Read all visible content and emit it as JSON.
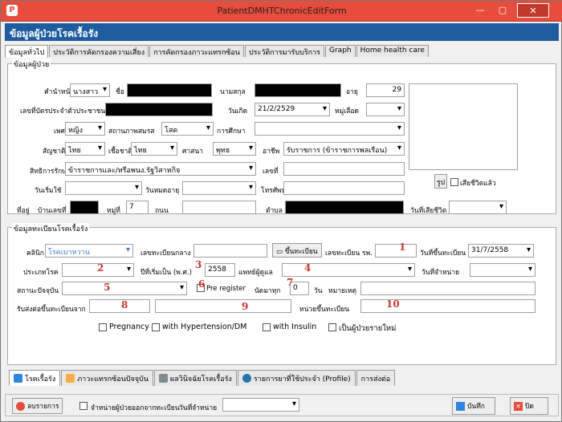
{
  "window": {
    "title": "PatientDMHTChronicEditForm",
    "app_icon": "P"
  },
  "header": {
    "title": "ข้อมูลผู้ป่วยโรคเรื้อรัง"
  },
  "tabs": [
    "ข้อมูลทั่วไป",
    "ประวัติการคัดกรองความเสี่ยง",
    "การคัดกรองภาวะแทรกซ้อน",
    "ประวัติการมารับบริการ",
    "Graph",
    "Home health care"
  ],
  "patient": {
    "group_title": "ข้อมูลผู้ป่วย",
    "prefix_label": "คำนำหน้า",
    "prefix_value": "นางสาว",
    "name_label": "ชื่อ",
    "surname_label": "นามสกุล",
    "age_label": "อายุ",
    "age_value": "29",
    "cid_label": "เลขที่บัตรประจำตัวประชาชน",
    "birth_label": "วันเกิด",
    "birth_value": "21/2/2529",
    "blood_label": "หมู่เลือด",
    "sex_label": "เพศ",
    "sex_value": "หญิง",
    "marital_label": "สถานภาพสมรส",
    "marital_value": "โสด",
    "education_label": "การศึกษา",
    "race_label": "สัญชาติ",
    "race_value": "ไทย",
    "nation_label": "เชื้อชาติ",
    "nation_value": "ไทย",
    "religion_label": "ศาสนา",
    "religion_value": "พุทธ",
    "occupation_label": "อาชีพ",
    "occupation_value": "รับราชการ (ข้าราชการพลเรือน)",
    "right_label": "สิทธิการรักษา",
    "right_value": "ข้าราชการและ/หรือพนง.รัฐวิสาหกิจ",
    "right_no_label": "เลขที่",
    "start_label": "วันเริ่มใช้",
    "expire_label": "วันหมดอายุ",
    "phone_label": "โทรศัพท์",
    "address_label": "ที่อยู่",
    "house_no_label": "บ้านเลขที่",
    "moo_label": "หมู่ที่",
    "moo_value": "7",
    "road_label": "ถนน",
    "tambon_label": "ตำบล",
    "death_label": "วันที่เสียชีวิต",
    "photo_label": "รูป",
    "dead_check_label": "เสียชีวิตแล้ว"
  },
  "registry": {
    "group_title": "ข้อมูลทะเบียนโรคเรื้อรัง",
    "clinic_label": "คลินิก",
    "clinic_value": "โรคเบาหวาน",
    "central_no_label": "เลขทะเบียนกลาง",
    "register_btn": "ขึ้นทะเบียน",
    "hosp_no_label": "เลขทะเบียน รพ.",
    "reg_date_label": "วันที่ขึ้นทะเบียน",
    "reg_date_value": "31/7/2558",
    "type_label": "ประเภทโรค",
    "year_label": "ปีที่เริ่มเป็น (พ.ศ.)",
    "year_value": "2558",
    "doctor_label": "แพทย์ผู้ดูแล",
    "discharge_label": "วันที่จำหน่าย",
    "status_label": "สถานะปัจจุบัน",
    "pre_register_label": "Pre register",
    "appoint_label": "นัดมาทุก",
    "appoint_value": "0",
    "day_label": "วัน",
    "note_label": "หมายเหตุ",
    "transfer_label": "รับส่งต่อขึ้นทะเบียนจาก",
    "unit_label": "หน่วยขึ้นทะเบียน",
    "checks": [
      "Pregnancy",
      "with Hypertension/DM",
      "with Insulin",
      "เป็นผู้ป่วยรายใหม่"
    ],
    "markers": [
      "1",
      "2",
      "3",
      "4",
      "5",
      "6",
      "7",
      "8",
      "9",
      "10"
    ]
  },
  "bottom_tabs": [
    "โรคเรื้อรัง",
    "ภาวะแทรกซ้อนปัจจุบัน",
    "ผลวินิจฉัยโรคเรื้อรัง",
    "รายการยาที่ใช้ประจำ (Profile)",
    "การส่งต่อ"
  ],
  "footer": {
    "delete_btn": "ลบรายการ",
    "discharge_check": "จำหน่ายผู้ป่วยออกจากทะเบียน",
    "discharge_date_label": "วันที่จำหน่าย",
    "save_btn": "บันทึก",
    "close_btn": "ปิด"
  },
  "colors": {
    "title_bar": "#e74c3c",
    "header": "#1e5c9f",
    "marker": "#c0392b",
    "selection": "#3d7fd6"
  }
}
